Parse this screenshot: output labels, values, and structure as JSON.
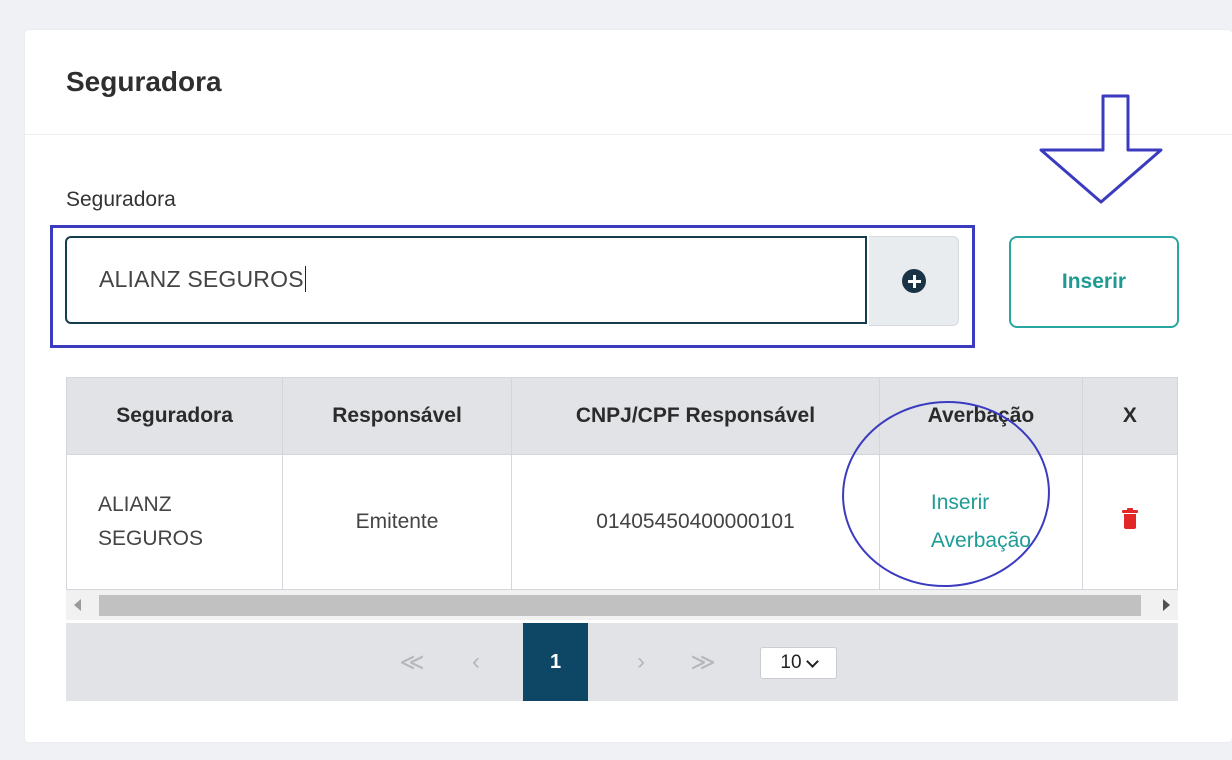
{
  "card": {
    "title": "Seguradora"
  },
  "form": {
    "field_label": "Seguradora",
    "input_value": "ALIANZ SEGUROS",
    "add_icon": "plus-circle-icon",
    "insert_button": "Inserir"
  },
  "table": {
    "headers": [
      "Seguradora",
      "Responsável",
      "CNPJ/CPF Responsável",
      "Averbação",
      "X"
    ],
    "rows": [
      {
        "seguradora_line1": "ALIANZ",
        "seguradora_line2": "SEGUROS",
        "responsavel": "Emitente",
        "cnpj_cpf": "01405450400000101",
        "averbacao_line1": "Inserir",
        "averbacao_line2": "Averbação",
        "delete_icon": "trash-icon"
      }
    ]
  },
  "pagination": {
    "first": "≪",
    "prev": "‹",
    "current_page": "1",
    "next": "›",
    "last": "≫",
    "page_size": "10"
  },
  "colors": {
    "accent_teal": "#1e9c95",
    "pager_active": "#0e4766",
    "annotation_blue": "#3b3bc0",
    "delete_red": "#e32727"
  }
}
